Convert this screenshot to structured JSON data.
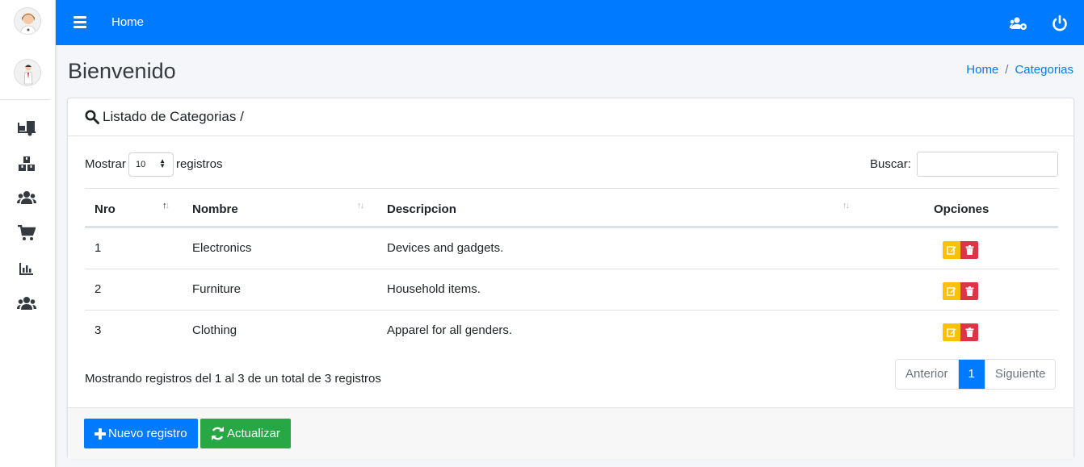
{
  "topbar": {
    "home_link": "Home"
  },
  "page": {
    "title": "Bienvenido"
  },
  "breadcrumb": {
    "home": "Home",
    "separator": "/",
    "current": "Categorias"
  },
  "card": {
    "title": "Listado de Categorias /",
    "length": {
      "label_before": "Mostrar",
      "value": "10",
      "label_after": "registros"
    },
    "search": {
      "label": "Buscar:",
      "value": ""
    },
    "columns": [
      "Nro",
      "Nombre",
      "Descripcion",
      "Opciones"
    ],
    "rows": [
      {
        "nro": "1",
        "nombre": "Electronics",
        "descripcion": "Devices and gadgets."
      },
      {
        "nro": "2",
        "nombre": "Furniture",
        "descripcion": "Household items."
      },
      {
        "nro": "3",
        "nombre": "Clothing",
        "descripcion": "Apparel for all genders."
      }
    ],
    "info": "Mostrando registros del 1 al 3 de un total de 3 registros",
    "pagination": {
      "prev": "Anterior",
      "current": "1",
      "next": "Siguiente"
    },
    "footer": {
      "new_button": "Nuevo registro",
      "refresh_button": "Actualizar"
    }
  },
  "colors": {
    "primary": "#007bff",
    "success": "#28a745",
    "warning": "#ffc107",
    "danger": "#dc3545"
  },
  "icons": {
    "sidebar": [
      "truck-loading-icon",
      "boxes-icon",
      "users-icon",
      "shopping-cart-icon",
      "chart-bar-icon",
      "users-icon"
    ],
    "topbar": [
      "users-cog-icon",
      "power-off-icon"
    ]
  }
}
